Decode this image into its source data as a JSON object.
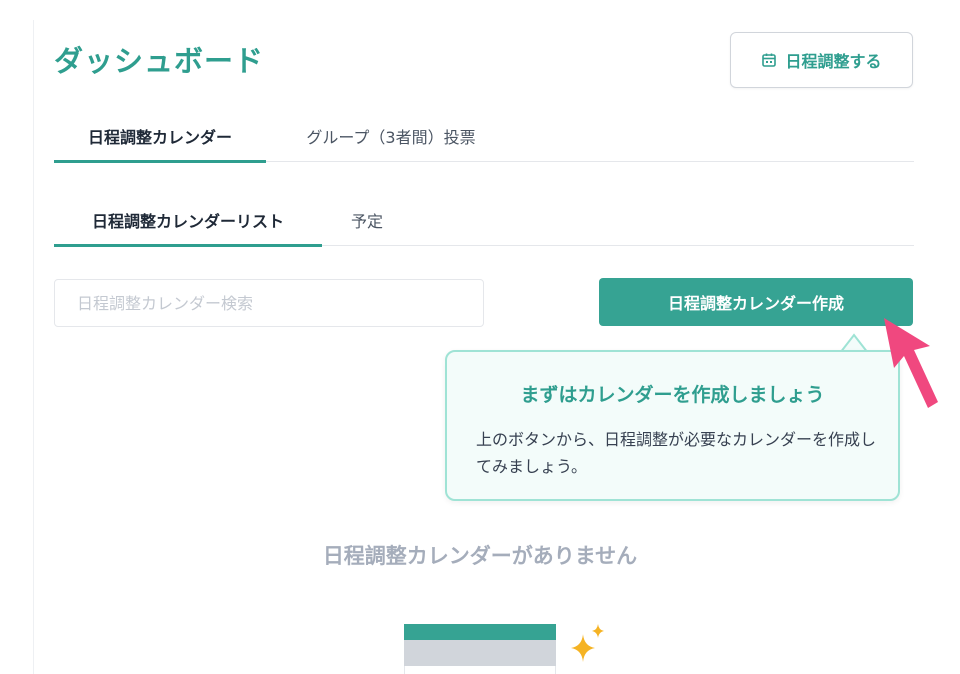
{
  "header": {
    "title": "ダッシュボード",
    "schedule_button_label": "日程調整する"
  },
  "main_tabs": [
    {
      "label": "日程調整カレンダー",
      "active": true
    },
    {
      "label": "グループ（3者間）投票",
      "active": false
    }
  ],
  "sub_tabs": [
    {
      "label": "日程調整カレンダーリスト",
      "active": true
    },
    {
      "label": "予定",
      "active": false
    }
  ],
  "search": {
    "placeholder": "日程調整カレンダー検索",
    "value": ""
  },
  "create_button_label": "日程調整カレンダー作成",
  "tooltip": {
    "title": "まずはカレンダーを作成しましょう",
    "body": "上のボタンから、日程調整が必要なカレンダーを作成してみましょう。"
  },
  "empty_state": {
    "message": "日程調整カレンダーがありません"
  },
  "colors": {
    "accent": "#36a393",
    "accent_text": "#2f9e8f",
    "tooltip_bg": "#f3fcfa",
    "tooltip_border": "#9fe3d5",
    "pointer": "#f0487f",
    "sparkle": "#f5b324"
  },
  "icons": {
    "schedule_button": "calendar-icon",
    "illustration_accent": "sparkle-icon",
    "tooltip_pointer": "pointer-arrow-icon"
  }
}
